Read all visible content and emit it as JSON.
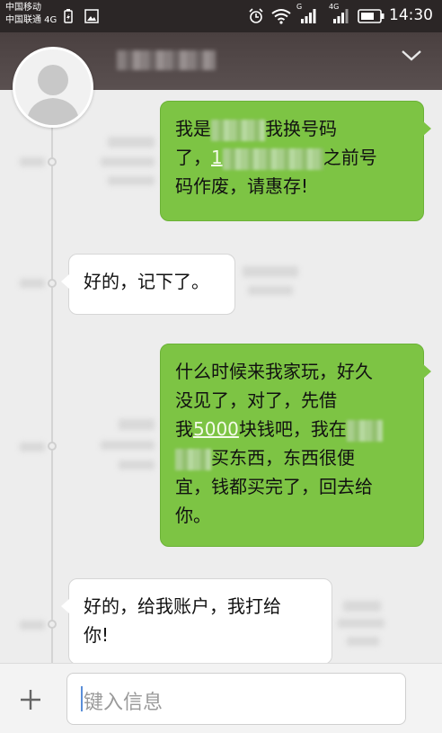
{
  "status_bar": {
    "carrier_1": "中国移动",
    "carrier_2": "中国联通 4G",
    "network_1": "G",
    "network_2": "4G",
    "time": "14:30"
  },
  "conversation": {
    "messages": [
      {
        "direction": "outgoing",
        "parts": [
          "我是",
          "我换号码",
          "了，",
          "1",
          "之前号",
          "码作废，请惠存!"
        ]
      },
      {
        "direction": "incoming",
        "text": "好的，记下了。"
      },
      {
        "direction": "outgoing",
        "parts": [
          "什么时候来我家玩，好久",
          "没见了，对了，先借",
          "我",
          "5000",
          "块钱吧，我在",
          "买东西，东西很便",
          "宜，钱都买完了，回去给",
          "你。"
        ]
      },
      {
        "direction": "incoming",
        "parts": [
          "好的，给我账户，我打给",
          "你!"
        ]
      }
    ]
  },
  "composer": {
    "placeholder": "键入信息"
  },
  "colors": {
    "outgoing_bubble": "#7dc444",
    "incoming_bubble": "#ffffff",
    "header": "#4a4040"
  }
}
